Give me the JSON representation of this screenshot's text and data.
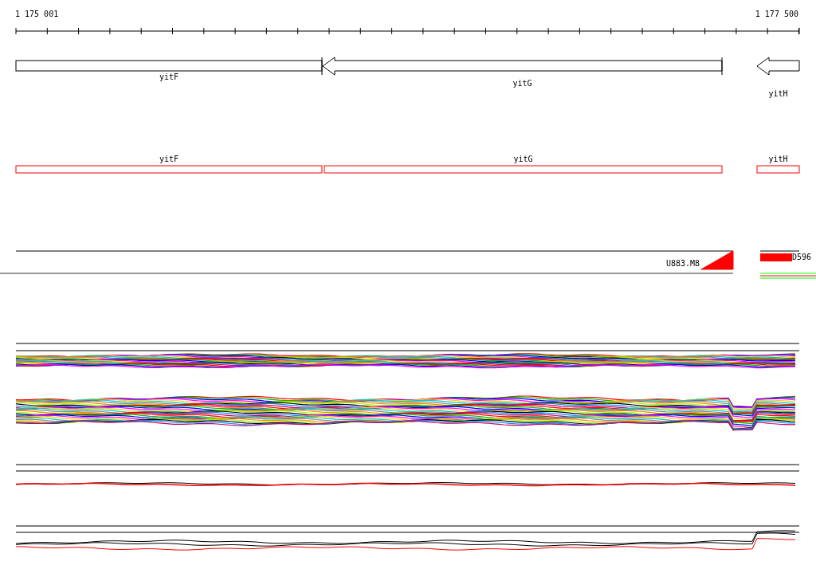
{
  "ruler": {
    "start": "1 175 001",
    "end": "1 177 500"
  },
  "genes": [
    {
      "label": "yitF",
      "kind": "box"
    },
    {
      "label": "yitG",
      "kind": "arrow"
    },
    {
      "label": "yitH",
      "kind": "arrow"
    }
  ],
  "annotations": [
    {
      "label": "yitF"
    },
    {
      "label": "yitG"
    },
    {
      "label": "yitH"
    }
  ],
  "markers": [
    {
      "label": "U883.M8",
      "kind": "ramp"
    },
    {
      "label": "D596",
      "kind": "bar"
    }
  ]
}
